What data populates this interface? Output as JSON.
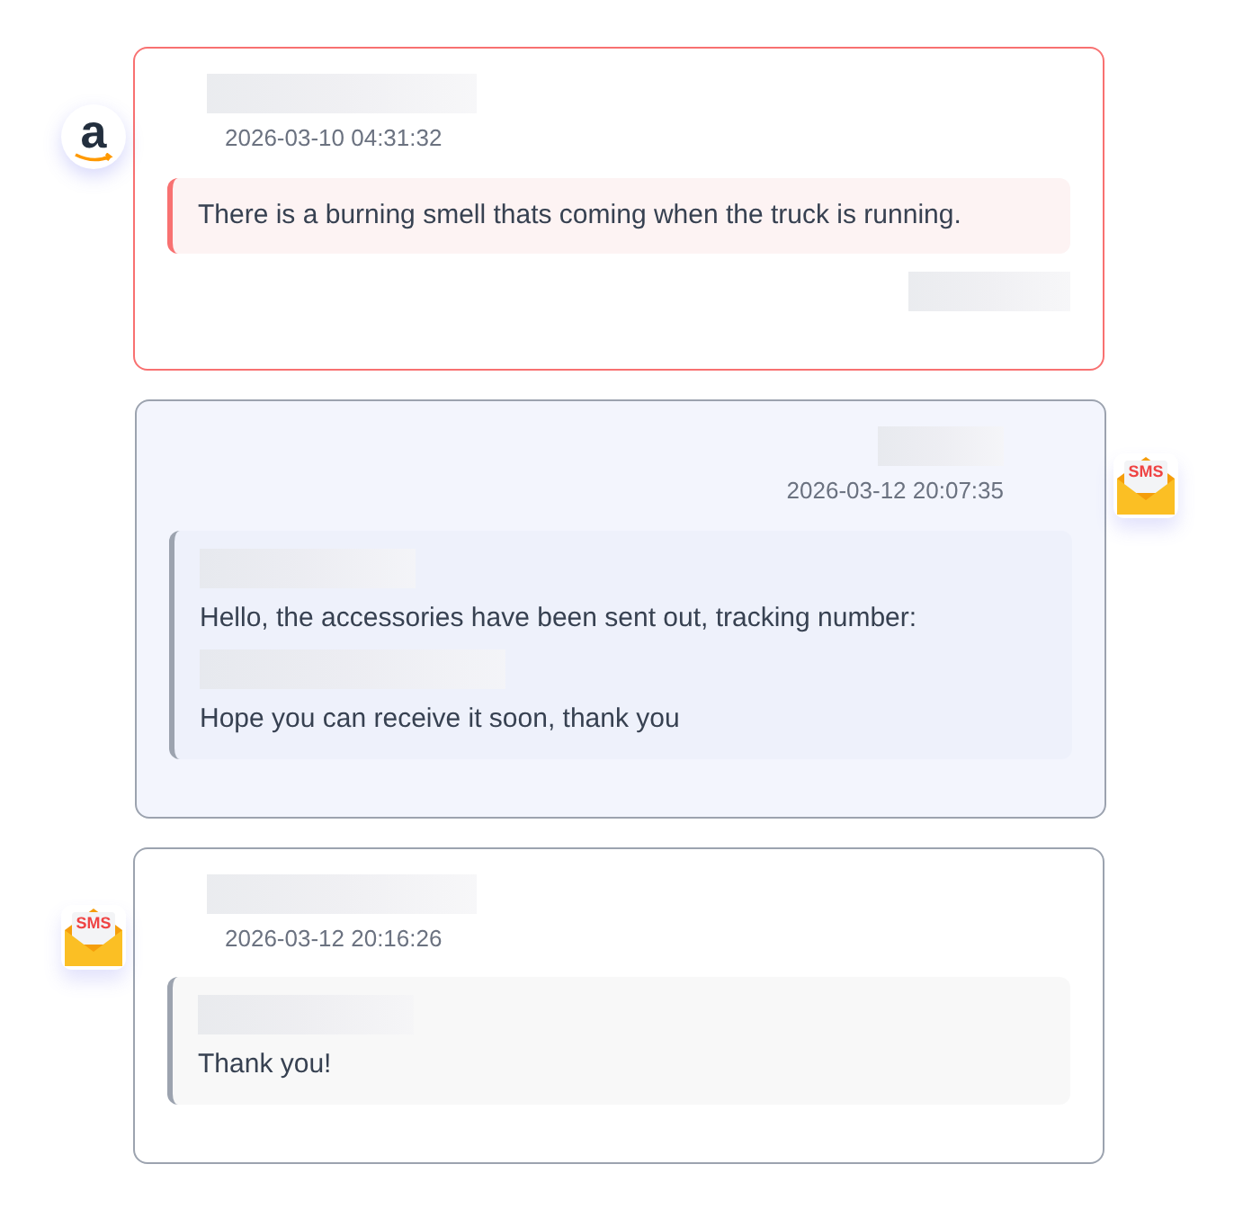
{
  "messages": [
    {
      "kind": "marketplace",
      "badge_text": "a",
      "highlighted": true,
      "timestamp": "2026-03-10 04:31:32",
      "lines": [
        {
          "kind": "text",
          "text": "There is a burning smell thats coming when the truck is running."
        }
      ]
    },
    {
      "kind": "reply",
      "badge_text": "SMS",
      "highlighted": false,
      "timestamp": "2026-03-12 20:07:35",
      "lines": [
        {
          "kind": "redacted"
        },
        {
          "kind": "text",
          "text": "Hello, the accessories have been sent out, tracking number:"
        },
        {
          "kind": "redacted"
        },
        {
          "kind": "text",
          "text": "Hope you can receive it soon, thank you"
        }
      ]
    },
    {
      "kind": "sms",
      "badge_text": "SMS",
      "highlighted": false,
      "timestamp": "2026-03-12 20:16:26",
      "lines": [
        {
          "kind": "redacted"
        },
        {
          "kind": "text",
          "text": "Thank you!"
        }
      ]
    }
  ]
}
